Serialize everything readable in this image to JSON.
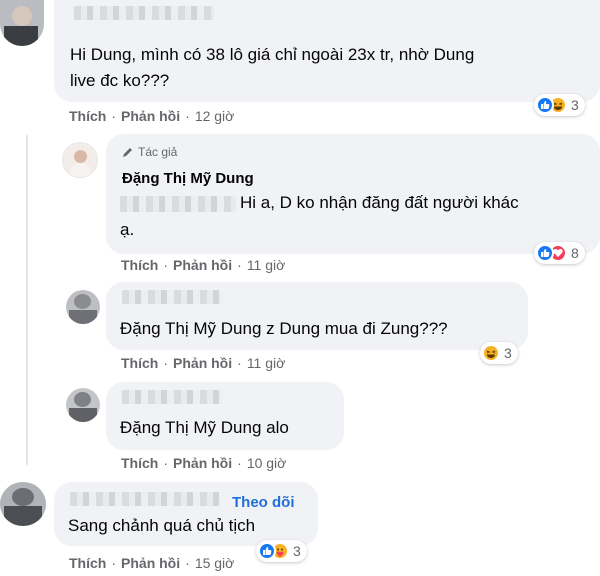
{
  "comments": [
    {
      "text": "Hi Dung, mình có 38 lô giá chỉ ngoài 23x tr, nhờ Dung live đc ko???",
      "actions": {
        "like": "Thích",
        "reply": "Phản hồi",
        "time": "12 giờ"
      },
      "reaction_count": "3",
      "reactions": [
        "like",
        "haha"
      ]
    },
    {
      "badge": "Tác giả",
      "name": "Đặng Thị Mỹ Dung",
      "text_line1": "Hi a, D ko nhận đăng đất người khác",
      "text_line2": "ạ.",
      "actions": {
        "like": "Thích",
        "reply": "Phản hồi",
        "time": "11 giờ"
      },
      "reaction_count": "8",
      "reactions": [
        "like",
        "love"
      ]
    },
    {
      "mention": "Đặng Thị Mỹ Dung",
      "text": "z Dung mua đi Zung???",
      "actions": {
        "like": "Thích",
        "reply": "Phản hồi",
        "time": "11 giờ"
      },
      "reaction_count": "3",
      "reactions": [
        "haha"
      ]
    },
    {
      "mention": "Đặng Thị Mỹ Dung",
      "text": "alo",
      "actions": {
        "like": "Thích",
        "reply": "Phản hồi",
        "time": "10 giờ"
      }
    },
    {
      "follow": "Theo dõi",
      "text": "Sang chảnh quá chủ tịch",
      "actions": {
        "like": "Thích",
        "reply": "Phản hồi",
        "time": "15 giờ"
      },
      "reaction_count": "3",
      "reactions": [
        "like",
        "care"
      ]
    }
  ],
  "colors": {
    "like": "#1877f2",
    "love": "#f33e58",
    "haha": "#f7b125",
    "link": "#216fdb"
  }
}
